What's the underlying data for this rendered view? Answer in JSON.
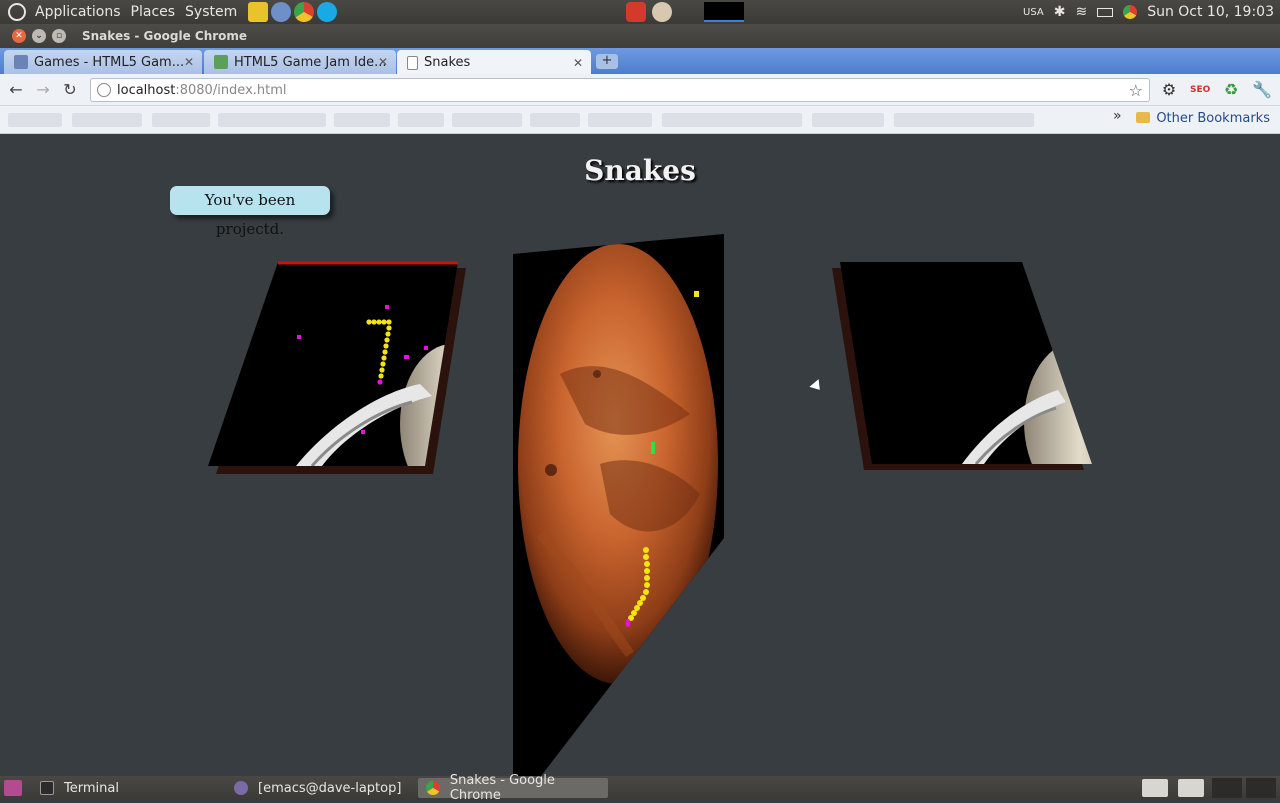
{
  "panel": {
    "menus": [
      "Applications",
      "Places",
      "System"
    ],
    "keyboard": "USA",
    "clock": "Sun Oct 10, 19:03"
  },
  "window": {
    "title": "Snakes - Google Chrome"
  },
  "tabs": [
    {
      "label": "Games - HTML5 Gam..."
    },
    {
      "label": "HTML5 Game Jam Ide..."
    },
    {
      "label": "Snakes"
    }
  ],
  "toolbar": {
    "url_host": "localhost",
    "url_rest": ":8080/index.html"
  },
  "bookmarks": {
    "other_label": "Other Bookmarks"
  },
  "game": {
    "title": "Snakes",
    "message": "You've been projectd."
  },
  "taskbar": [
    {
      "label": "Terminal"
    },
    {
      "label": "[emacs@dave-laptop]"
    },
    {
      "label": "Snakes - Google Chrome"
    }
  ],
  "colors": {
    "page_bg": "#373d40",
    "bubble_bg": "#b7e3ef",
    "snake_yellow": "#f5e414",
    "food_magenta": "#e810e0",
    "tab_strip": "#5f8ed8"
  }
}
